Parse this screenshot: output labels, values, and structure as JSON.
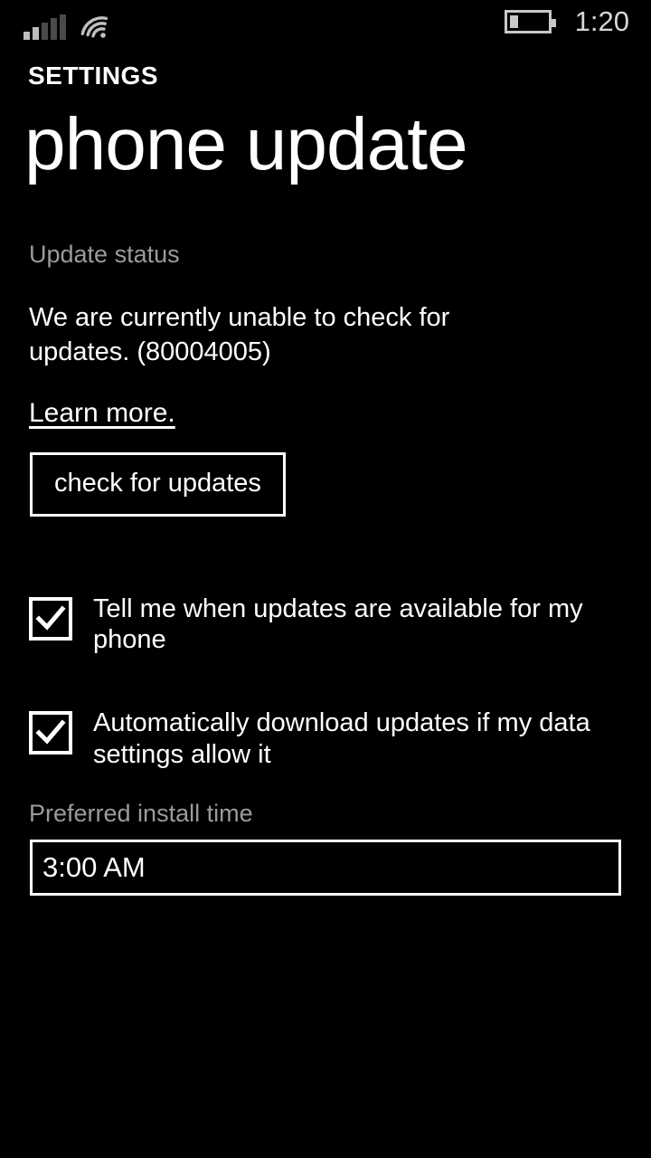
{
  "status_bar": {
    "signal": {
      "icon": "signal-bars-icon",
      "bars_total": 5,
      "bars_filled": 2
    },
    "wifi": {
      "icon": "wifi-icon"
    },
    "battery": {
      "icon": "battery-icon",
      "level_percent": 20
    },
    "clock": "1:20"
  },
  "header": {
    "app_title": "SETTINGS",
    "page_title": "phone update"
  },
  "update_status": {
    "label": "Update status",
    "message": "We are currently unable to check for updates. (80004005)",
    "error_code": "80004005",
    "learn_more": "Learn more.",
    "check_button": "check for updates"
  },
  "options": [
    {
      "label": "Tell me when updates are available for my phone",
      "checked": true,
      "name": "notify-updates"
    },
    {
      "label": "Automatically download updates if my data settings allow it",
      "checked": true,
      "name": "auto-download-updates"
    }
  ],
  "install_time": {
    "label": "Preferred install time",
    "value": "3:00 AM"
  },
  "colors": {
    "background": "#000000",
    "foreground": "#ffffff",
    "muted": "#9b9b9b",
    "status_icon": "#c8c8c8"
  }
}
